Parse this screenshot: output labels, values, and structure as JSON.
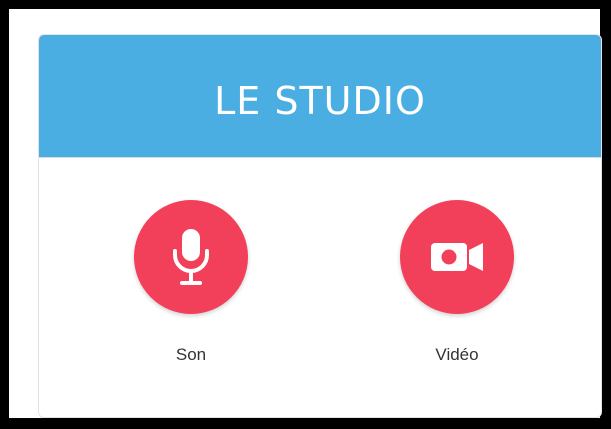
{
  "studio": {
    "title": "LE STUDIO",
    "accent_color": "#4aaee3",
    "button_color": "#f2405b",
    "actions": [
      {
        "label": "Son",
        "icon": "microphone-icon"
      },
      {
        "label": "Vidéo",
        "icon": "video-camera-icon"
      }
    ]
  }
}
